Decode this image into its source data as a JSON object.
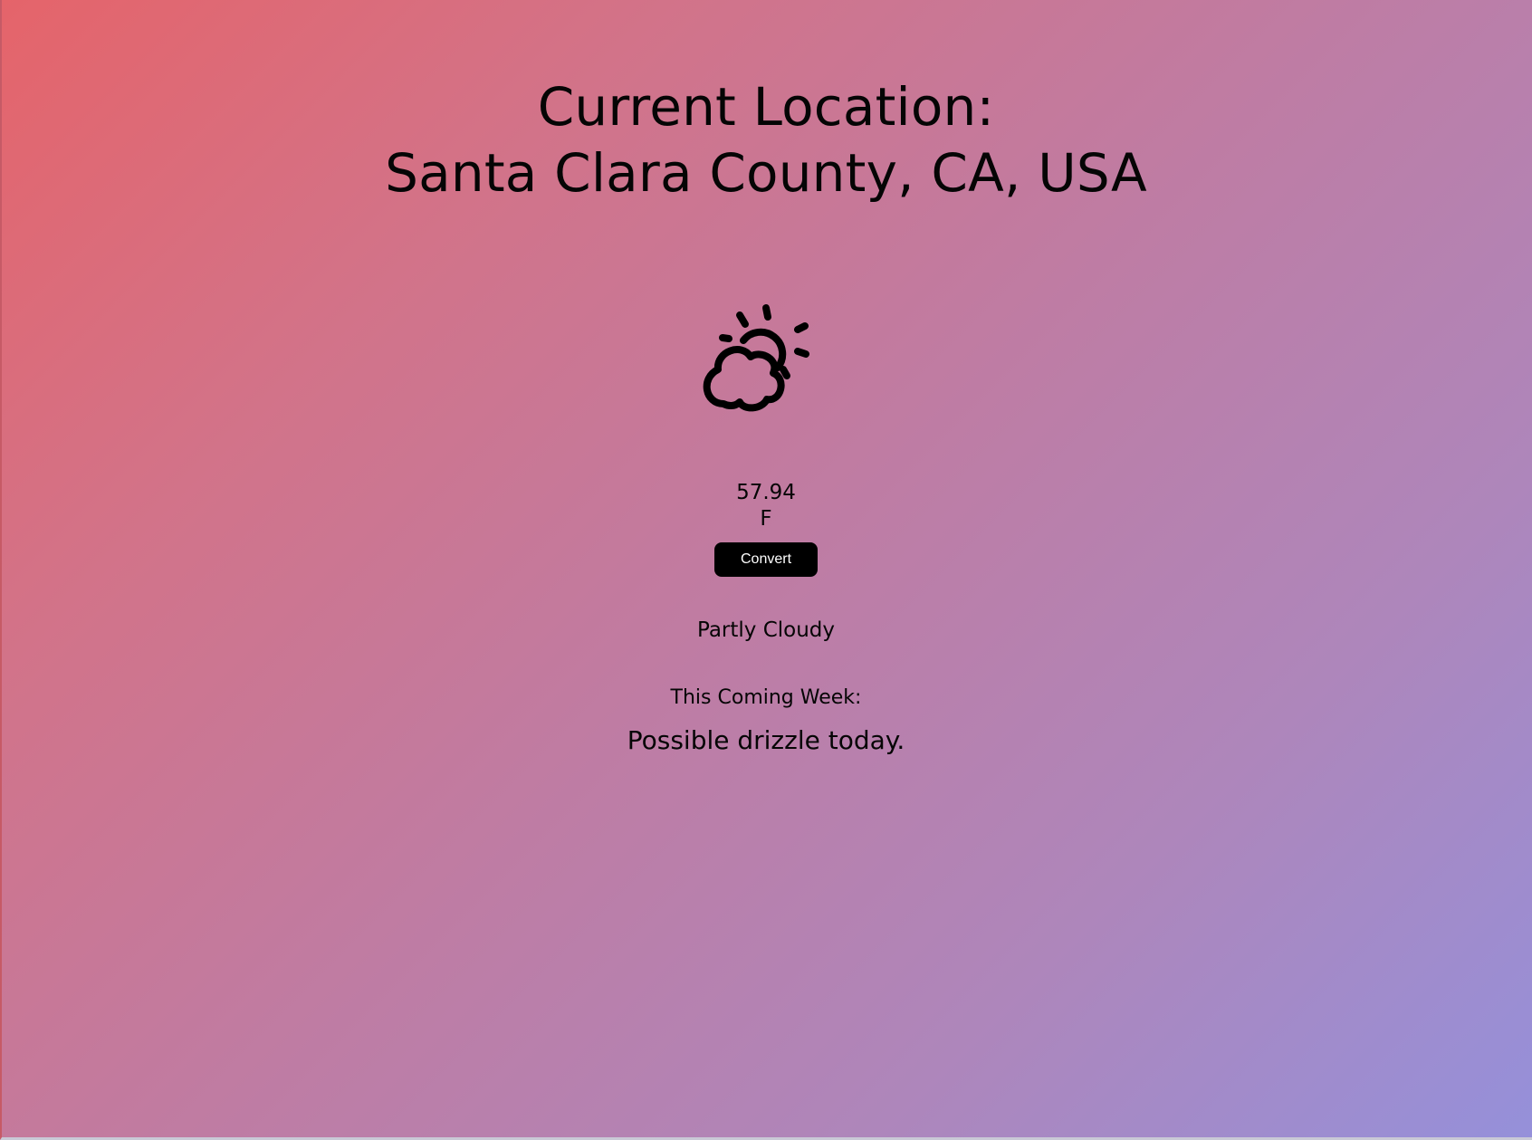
{
  "location": {
    "line1": "Current Location:",
    "line2": "Santa Clara County, CA, USA"
  },
  "current": {
    "icon": "partly-cloudy-icon",
    "temperature": "57.94",
    "unit": "F",
    "convert_label": "Convert",
    "condition": "Partly Cloudy"
  },
  "week": {
    "heading": "This Coming Week:",
    "summary": "Possible drizzle today."
  }
}
